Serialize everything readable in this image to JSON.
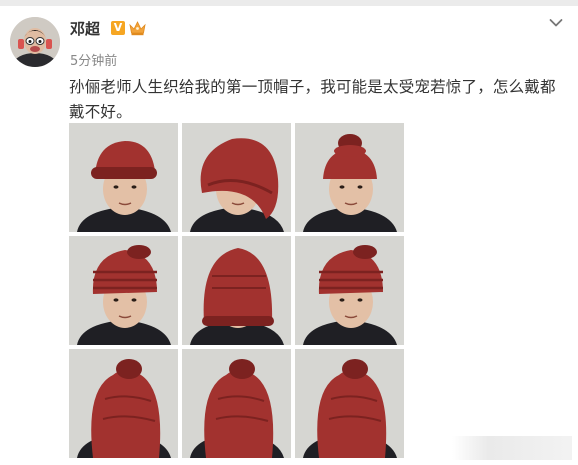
{
  "post": {
    "username": "邓超",
    "verified_badge": "V",
    "crown_icon": "crown-icon",
    "timestamp": "5分钟前",
    "text": "孙俪老师人生织给我的第一顶帽子，我可能是太受宠若惊了，怎么戴都戴不好。",
    "menu_icon": "chevron-down-icon"
  },
  "photos": [
    {
      "name": "photo-hat-front-left",
      "hat_style": "rolled-brim",
      "view": "three-quarter-left"
    },
    {
      "name": "photo-hat-back",
      "hat_style": "slouchy",
      "view": "back"
    },
    {
      "name": "photo-hat-front",
      "hat_style": "topknot",
      "view": "front"
    },
    {
      "name": "photo-hat-side-left",
      "hat_style": "stacked",
      "view": "profile-left"
    },
    {
      "name": "photo-hat-over-eyes",
      "hat_style": "pulled-down",
      "view": "front"
    },
    {
      "name": "photo-hat-tilted",
      "hat_style": "stacked",
      "view": "front-tilted"
    },
    {
      "name": "photo-hat-full-cover-profile",
      "hat_style": "full-cover",
      "view": "profile-left"
    },
    {
      "name": "photo-hat-full-cover-front",
      "hat_style": "full-cover",
      "view": "front"
    },
    {
      "name": "photo-hat-full-cover-right",
      "hat_style": "full-cover",
      "view": "profile-right"
    }
  ],
  "colors": {
    "hat": "#a2322f",
    "hat_dark": "#7c2220",
    "sweater": "#1f1f24",
    "background_wall": "#d6d6d2",
    "skin": "#e3c0a6",
    "hair": "#1a1613",
    "badge": "#f6a623"
  }
}
